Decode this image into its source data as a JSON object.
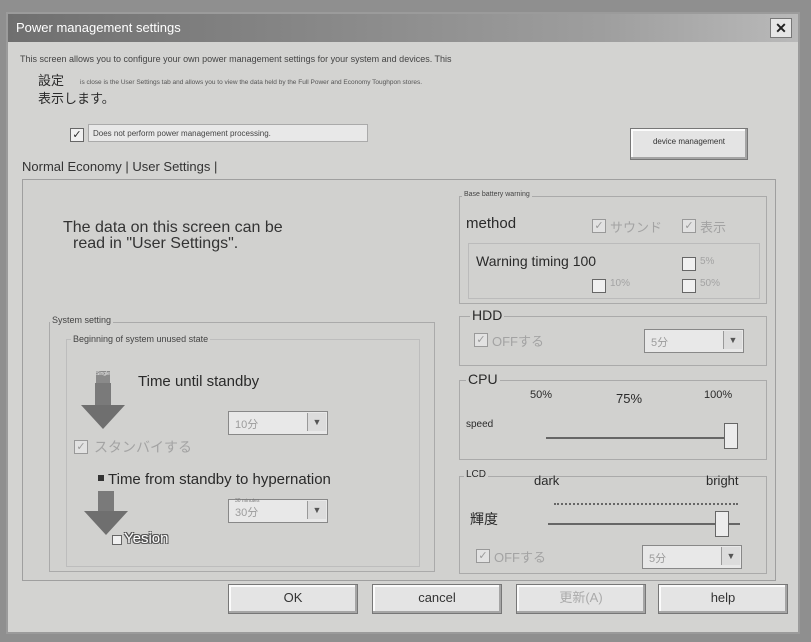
{
  "window": {
    "title": "Power management settings",
    "close": "✕"
  },
  "intro": {
    "line1": "This screen allows you to configure your own power management settings for your system and devices. This",
    "jp_line1": "設定",
    "jp_line2": "表示します。",
    "line2": "is close is the User Settings tab and allows you to view the data held by the Full Power and Economy Toughpon stores."
  },
  "no_pm": {
    "checked": "✓",
    "label": "Does not perform power management processing."
  },
  "device_mgmt_button": "device management",
  "tabs": {
    "normal_economy": "Normal Economy",
    "sep1": "|",
    "user_settings": "User Settings",
    "sep2": "|"
  },
  "info_text": {
    "line1": "The data on this screen can be",
    "line2": "read in \"User Settings\"."
  },
  "system_setting": {
    "legend": "System setting",
    "sublabel": "Beginning of system unused state",
    "standby_icon_label": "Single",
    "time_until_standby": "Time until standby",
    "standby_value": "10分",
    "standby_check_label": "スタンバイする",
    "time_to_hibernation": "Time from standby to hypernation",
    "hibernation_top": "30 minutes",
    "hibernation_value": "30分",
    "yesion_label": "Yesion"
  },
  "battery": {
    "legend": "Base battery warning",
    "method": "method",
    "sound": "サウンド",
    "display": "表示",
    "warning_timing": "Warning timing 100",
    "p_b": "5%",
    "p_c": "10%",
    "p_d": "50%"
  },
  "hdd": {
    "legend": "HDD",
    "off_label": "OFFする",
    "value": "5分"
  },
  "cpu": {
    "legend": "CPU",
    "speed": "speed",
    "t50": "50%",
    "t75": "75%",
    "t100": "100%",
    "level": 1.0
  },
  "lcd": {
    "legend": "LCD",
    "dark": "dark",
    "bright": "bright",
    "brightness": "輝度",
    "off_label": "OFFする",
    "value": "5分",
    "level": 0.9
  },
  "buttons": {
    "ok": "OK",
    "cancel": "cancel",
    "apply": "更新(A)",
    "help": "help"
  }
}
